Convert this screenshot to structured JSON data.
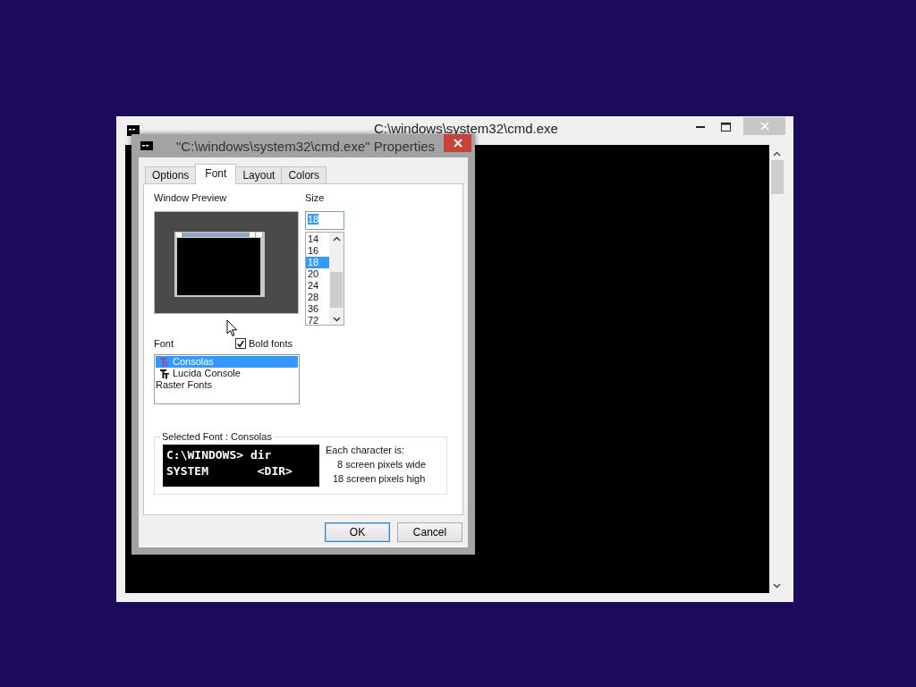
{
  "console_window": {
    "title": "C:\\windows\\system32\\cmd.exe"
  },
  "dialog": {
    "title": "\"C:\\windows\\system32\\cmd.exe\" Properties",
    "tabs": [
      {
        "label": "Options",
        "selected": false
      },
      {
        "label": "Font",
        "selected": true
      },
      {
        "label": "Layout",
        "selected": false
      },
      {
        "label": "Colors",
        "selected": false
      }
    ],
    "window_preview_label": "Window Preview",
    "size": {
      "label": "Size",
      "value": "18",
      "options": [
        {
          "label": "14",
          "selected": false
        },
        {
          "label": "16",
          "selected": false
        },
        {
          "label": "18",
          "selected": true
        },
        {
          "label": "20",
          "selected": false
        },
        {
          "label": "24",
          "selected": false
        },
        {
          "label": "28",
          "selected": false
        },
        {
          "label": "36",
          "selected": false
        },
        {
          "label": "72",
          "selected": false
        }
      ]
    },
    "font": {
      "label": "Font",
      "bold_fonts": {
        "label": "Bold fonts",
        "checked": true
      },
      "fonts": [
        {
          "name": "Consolas",
          "kind": "truetype",
          "selected": true
        },
        {
          "name": "Lucida Console",
          "kind": "truetype",
          "selected": false
        },
        {
          "name": "Raster Fonts",
          "kind": "raster",
          "selected": false
        }
      ]
    },
    "selected_font": {
      "legend": "Selected Font : Consolas",
      "sample_lines": [
        "C:\\WINDOWS> dir",
        "SYSTEM       <DIR>"
      ],
      "info": [
        "Each character is:",
        "8 screen pixels wide",
        "18 screen pixels high"
      ]
    },
    "buttons": [
      {
        "label": "OK",
        "default": true
      },
      {
        "label": "Cancel",
        "default": false
      }
    ]
  }
}
